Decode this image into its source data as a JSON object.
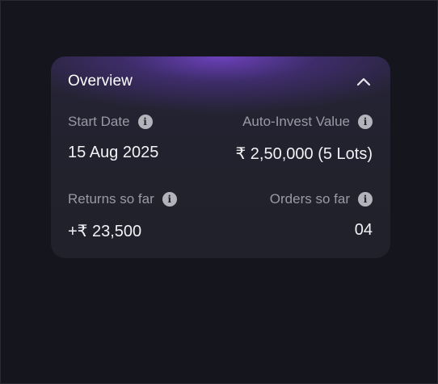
{
  "overview": {
    "title": "Overview",
    "collapse_icon": "chevron-up-icon",
    "start_date": {
      "label": "Start Date",
      "value": "15 Aug 2025"
    },
    "auto_invest_value": {
      "label": "Auto-Invest Value",
      "value": "₹ 2,50,000 (5 Lots)"
    },
    "returns_so_far": {
      "label": "Returns so far",
      "value": "+₹ 23,500"
    },
    "orders_so_far": {
      "label": "Orders so far",
      "value": "04"
    },
    "info_glyph": "i"
  },
  "colors": {
    "page_background": "#16161f",
    "card_background": "#22222e",
    "header_glow": "#7846d2",
    "label_text": "#9a9aa5",
    "value_text": "#f2f2f5"
  }
}
